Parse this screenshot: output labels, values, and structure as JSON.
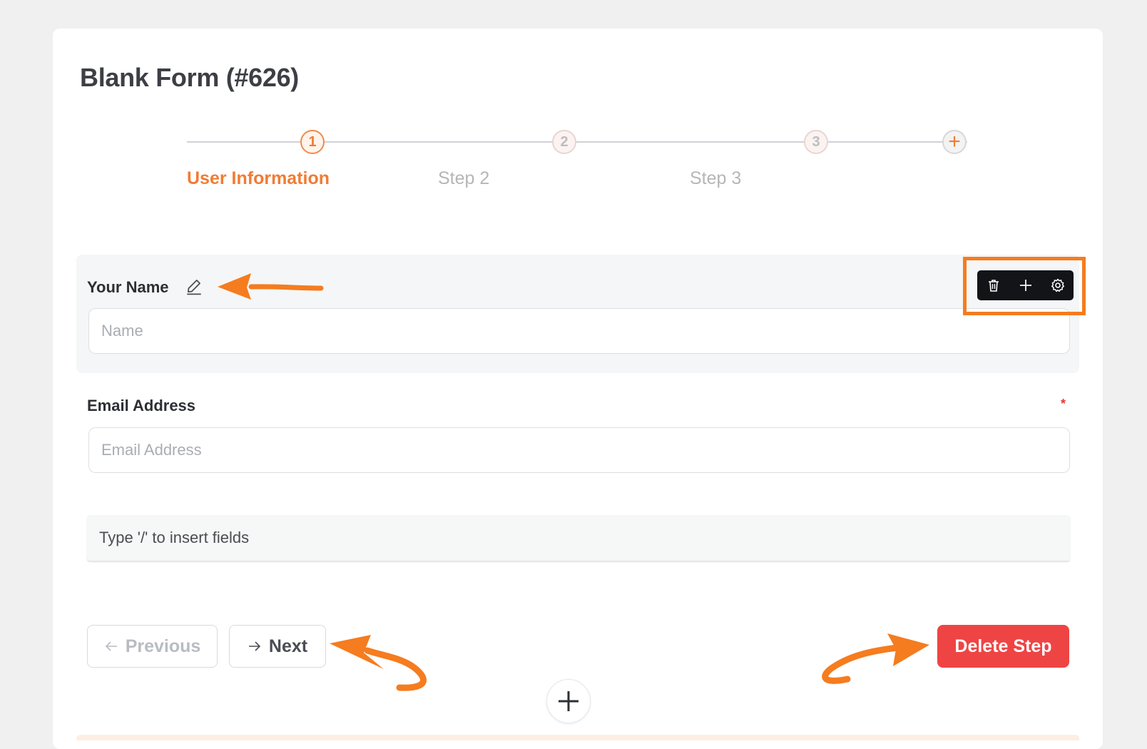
{
  "form": {
    "title": "Blank Form (#626)"
  },
  "stepper": {
    "steps": [
      {
        "number": "1",
        "label": "User Information",
        "state": "active"
      },
      {
        "number": "2",
        "label": "Step 2",
        "state": "inactive"
      },
      {
        "number": "3",
        "label": "Step 3",
        "state": "inactive"
      }
    ],
    "add_symbol": "+"
  },
  "fields": {
    "name": {
      "label": "Your Name",
      "placeholder": "Name"
    },
    "email": {
      "label": "Email Address",
      "placeholder": "Email Address",
      "required_mark": "*"
    }
  },
  "inserter": {
    "placeholder": "Type '/' to insert fields"
  },
  "toolbar": {
    "icons": [
      "trash-icon",
      "plus-icon",
      "gear-icon"
    ]
  },
  "navigation": {
    "previous_label": "Previous",
    "next_label": "Next",
    "delete_label": "Delete Step"
  },
  "colors": {
    "accent": "#f07c34",
    "annotation": "#f57c1f",
    "danger": "#ef4444",
    "toolbar_bg": "#121417"
  }
}
